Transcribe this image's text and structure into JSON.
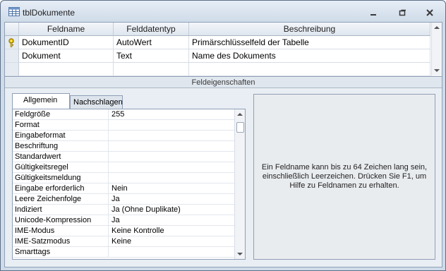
{
  "window": {
    "title": "tblDokumente",
    "icon": "table-icon",
    "controls": [
      "minimize-icon",
      "restore-icon",
      "close-icon"
    ]
  },
  "grid": {
    "headers": [
      "Feldname",
      "Felddatentyp",
      "Beschreibung"
    ],
    "rows": [
      {
        "name": "DokumentID",
        "type": "AutoWert",
        "desc": "Primärschlüsselfeld der Tabelle",
        "primary_key": true
      },
      {
        "name": "Dokument",
        "type": "Text",
        "desc": "Name des Dokuments",
        "primary_key": false
      }
    ]
  },
  "section_label": "Feldeigenschaften",
  "tabs": [
    "Allgemein",
    "Nachschlagen"
  ],
  "properties": [
    {
      "name": "Feldgröße",
      "value": "255"
    },
    {
      "name": "Format",
      "value": ""
    },
    {
      "name": "Eingabeformat",
      "value": ""
    },
    {
      "name": "Beschriftung",
      "value": ""
    },
    {
      "name": "Standardwert",
      "value": ""
    },
    {
      "name": "Gültigkeitsregel",
      "value": ""
    },
    {
      "name": "Gültigkeitsmeldung",
      "value": ""
    },
    {
      "name": "Eingabe erforderlich",
      "value": "Nein"
    },
    {
      "name": "Leere Zeichenfolge",
      "value": "Ja"
    },
    {
      "name": "Indiziert",
      "value": "Ja (Ohne Duplikate)"
    },
    {
      "name": "Unicode-Kompression",
      "value": "Ja"
    },
    {
      "name": "IME-Modus",
      "value": "Keine Kontrolle"
    },
    {
      "name": "IME-Satzmodus",
      "value": "Keine"
    },
    {
      "name": "Smarttags",
      "value": ""
    }
  ],
  "help_text": "Ein Feldname kann bis zu 64 Zeichen lang sein, einschließlich Leerzeichen. Drücken Sie F1, um Hilfe zu Feldnamen zu erhalten.",
  "colors": {
    "accent": "#cfdbe9",
    "border": "#8f9fb6",
    "key": "#d9b400"
  }
}
